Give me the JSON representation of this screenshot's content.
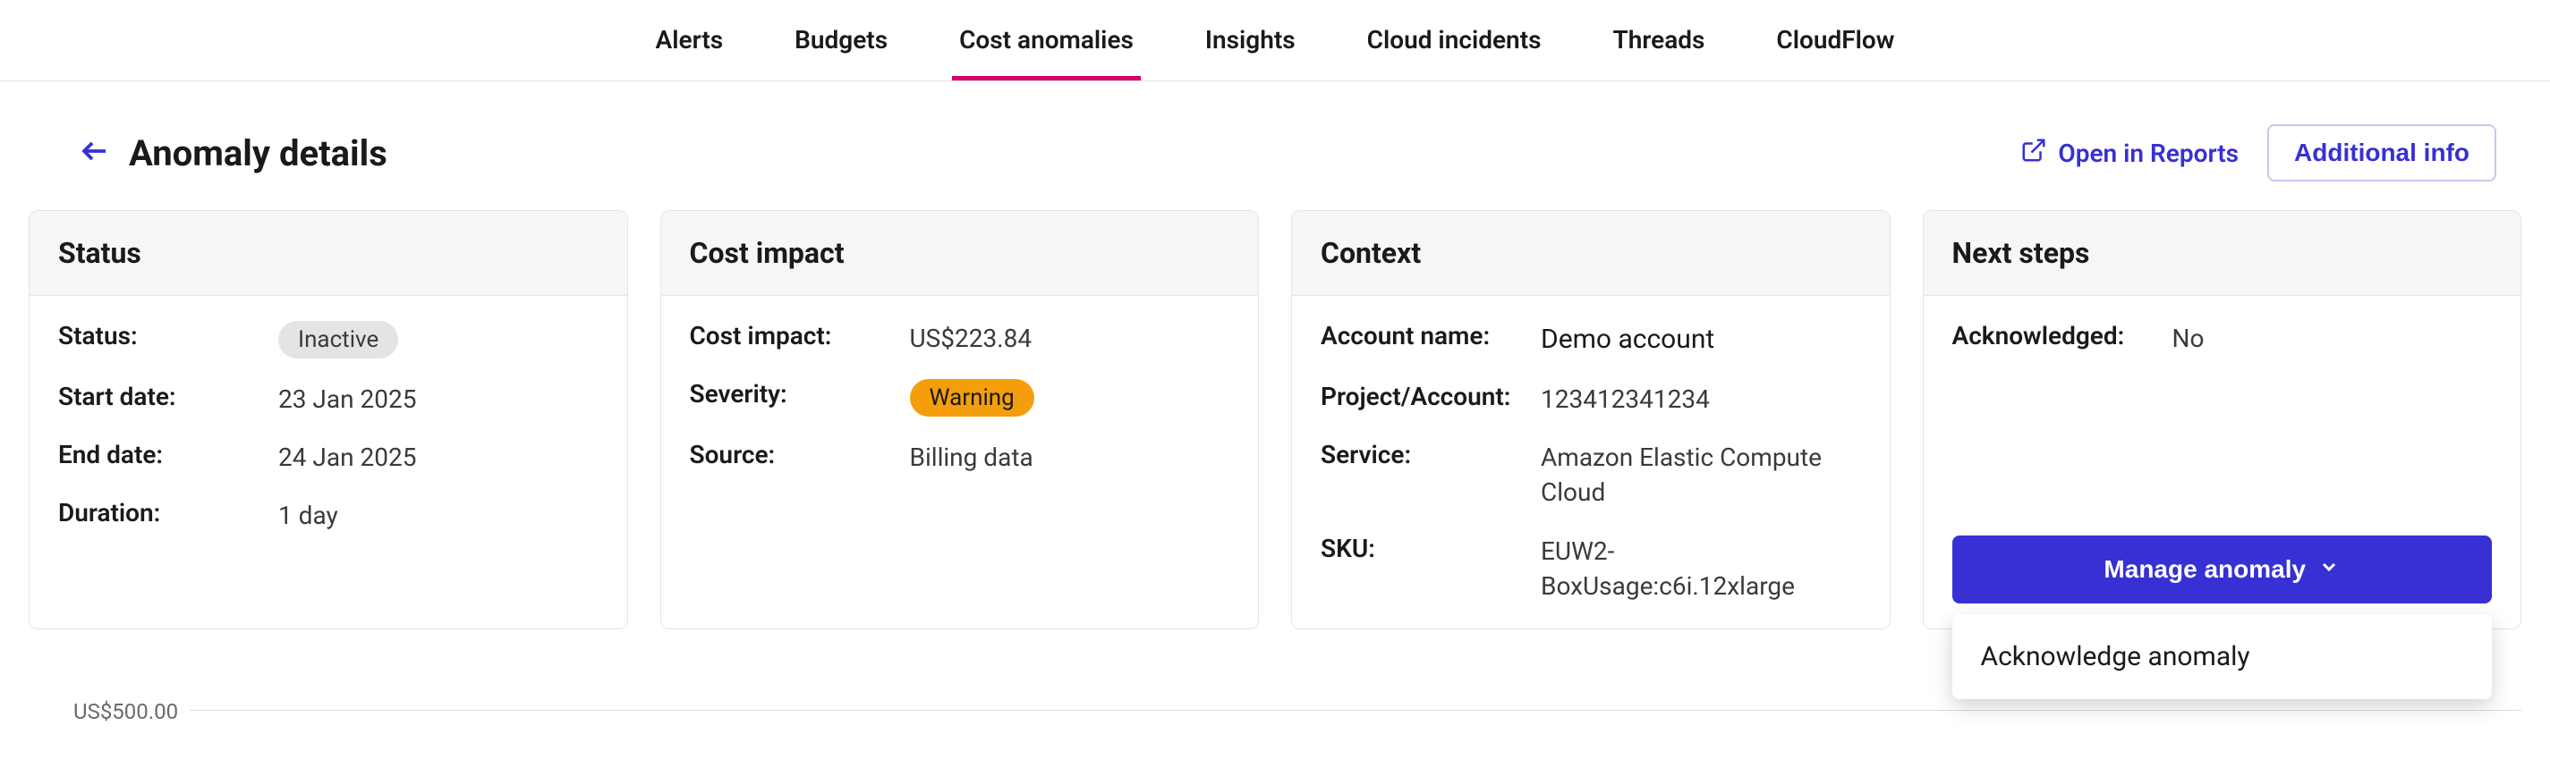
{
  "tabs": [
    {
      "label": "Alerts"
    },
    {
      "label": "Budgets"
    },
    {
      "label": "Cost anomalies",
      "active": true
    },
    {
      "label": "Insights"
    },
    {
      "label": "Cloud incidents"
    },
    {
      "label": "Threads"
    },
    {
      "label": "CloudFlow"
    }
  ],
  "page": {
    "title": "Anomaly details",
    "open_in_reports": "Open in Reports",
    "additional_info": "Additional info"
  },
  "cards": {
    "status": {
      "title": "Status",
      "rows": {
        "status_label": "Status:",
        "status_value": "Inactive",
        "start_label": "Start date:",
        "start_value": "23 Jan 2025",
        "end_label": "End date:",
        "end_value": "24 Jan 2025",
        "duration_label": "Duration:",
        "duration_value": "1 day"
      }
    },
    "cost": {
      "title": "Cost impact",
      "rows": {
        "impact_label": "Cost impact:",
        "impact_value": "US$223.84",
        "severity_label": "Severity:",
        "severity_value": "Warning",
        "source_label": "Source:",
        "source_value": "Billing data"
      }
    },
    "context": {
      "title": "Context",
      "rows": {
        "account_label": "Account name:",
        "account_value": "Demo account",
        "project_label": "Project/Account:",
        "project_value": "123412341234",
        "service_label": "Service:",
        "service_value": "Amazon Elastic Compute Cloud",
        "sku_label": "SKU:",
        "sku_value": "EUW2-BoxUsage:c6i.12xlarge"
      }
    },
    "next": {
      "title": "Next steps",
      "ack_label": "Acknowledged:",
      "ack_value": "No",
      "manage_label": "Manage anomaly",
      "dropdown_item": "Acknowledge anomaly"
    }
  },
  "chart": {
    "y_label_top": "US$500.00"
  }
}
